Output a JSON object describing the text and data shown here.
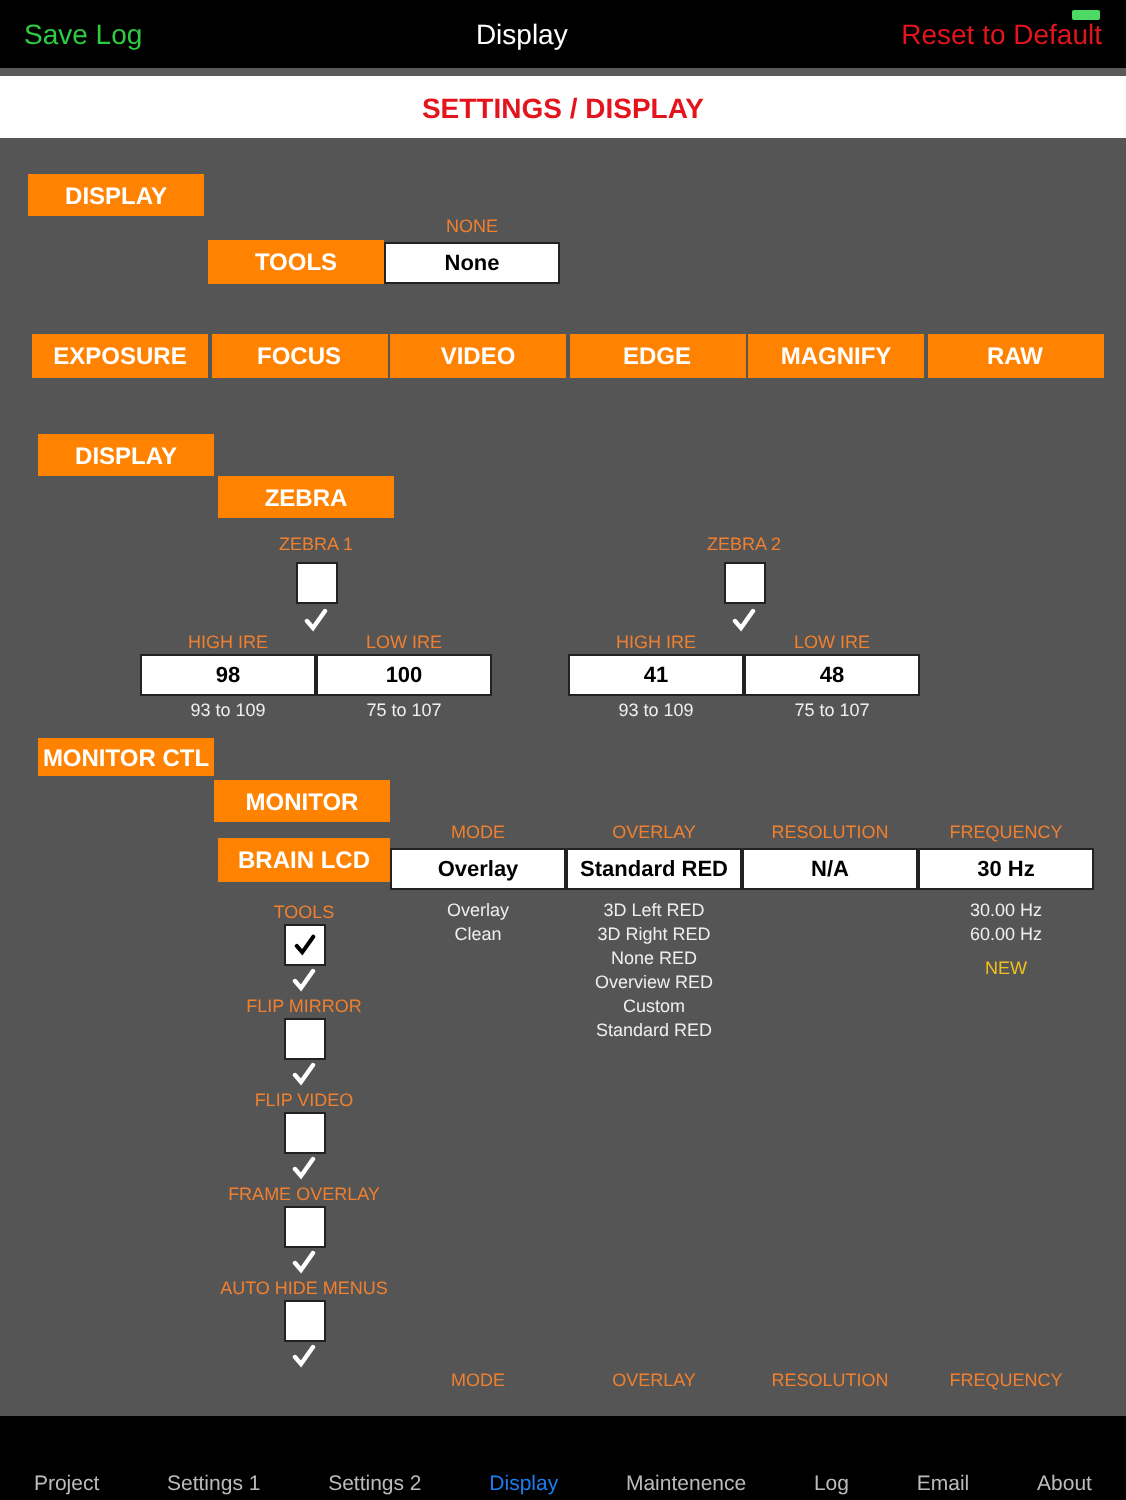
{
  "nav_bar": {
    "left": "Save Log",
    "title": "Display",
    "right": "Reset to Default"
  },
  "page_title": "SETTINGS / DISPLAY",
  "display_section": {
    "main_button": "DISPLAY",
    "sub_button": "TOOLS",
    "field_label": "NONE",
    "field_value": "None"
  },
  "segments": [
    {
      "label": "EXPOSURE",
      "selected": false
    },
    {
      "label": "FOCUS",
      "selected": false
    },
    {
      "label": "VIDEO",
      "selected": false
    },
    {
      "label": "EDGE",
      "selected": false
    },
    {
      "label": "MAGNIFY",
      "selected": false
    },
    {
      "label": "RAW",
      "selected": false
    }
  ],
  "zebra_section": {
    "main_button": "DISPLAY",
    "sub_button": "ZEBRA",
    "zebras": [
      {
        "label": "ZEBRA 1",
        "checked": false,
        "high_label": "HIGH IRE",
        "high_value": "98",
        "high_range": "93 to 109",
        "low_label": "LOW IRE",
        "low_value": "100",
        "low_range": "75 to 107"
      },
      {
        "label": "ZEBRA 2",
        "checked": false,
        "high_label": "HIGH IRE",
        "high_value": "41",
        "high_range": "93 to 109",
        "low_label": "LOW IRE",
        "low_value": "48",
        "low_range": "75 to 107"
      }
    ]
  },
  "monitor_section": {
    "main_button": "MONITOR CTL",
    "sub_button": "MONITOR",
    "row_button": "BRAIN LCD",
    "columns": [
      {
        "header": "MODE",
        "value": "Overlay",
        "options": [
          "Overlay",
          "Clean"
        ]
      },
      {
        "header": "OVERLAY",
        "value": "Standard RED",
        "options": [
          "3D Left RED",
          "3D Right RED",
          "None RED",
          "Overview RED",
          "Custom",
          "Standard RED"
        ]
      },
      {
        "header": "RESOLUTION",
        "value": "N/A"
      },
      {
        "header": "FREQUENCY",
        "value": "30 Hz",
        "options": [
          "30.00 Hz",
          "60.00 Hz"
        ],
        "note": "NEW"
      }
    ],
    "toggles": [
      {
        "label": "TOOLS",
        "checked": true
      },
      {
        "label": "FLIP MIRROR",
        "checked": false
      },
      {
        "label": "FLIP VIDEO",
        "checked": false
      },
      {
        "label": "FRAME OVERLAY",
        "checked": false
      },
      {
        "label": "AUTO HIDE MENUS",
        "checked": false
      }
    ],
    "next_headers": [
      "MODE",
      "OVERLAY",
      "RESOLUTION",
      "FREQUENCY"
    ]
  },
  "tab_bar": [
    {
      "label": "Project",
      "selected": false
    },
    {
      "label": "Settings 1",
      "selected": false
    },
    {
      "label": "Settings 2",
      "selected": false
    },
    {
      "label": "Display",
      "selected": true
    },
    {
      "label": "Maintenence",
      "selected": false
    },
    {
      "label": "Log",
      "selected": false
    },
    {
      "label": "Email",
      "selected": false
    },
    {
      "label": "About",
      "selected": false
    }
  ]
}
